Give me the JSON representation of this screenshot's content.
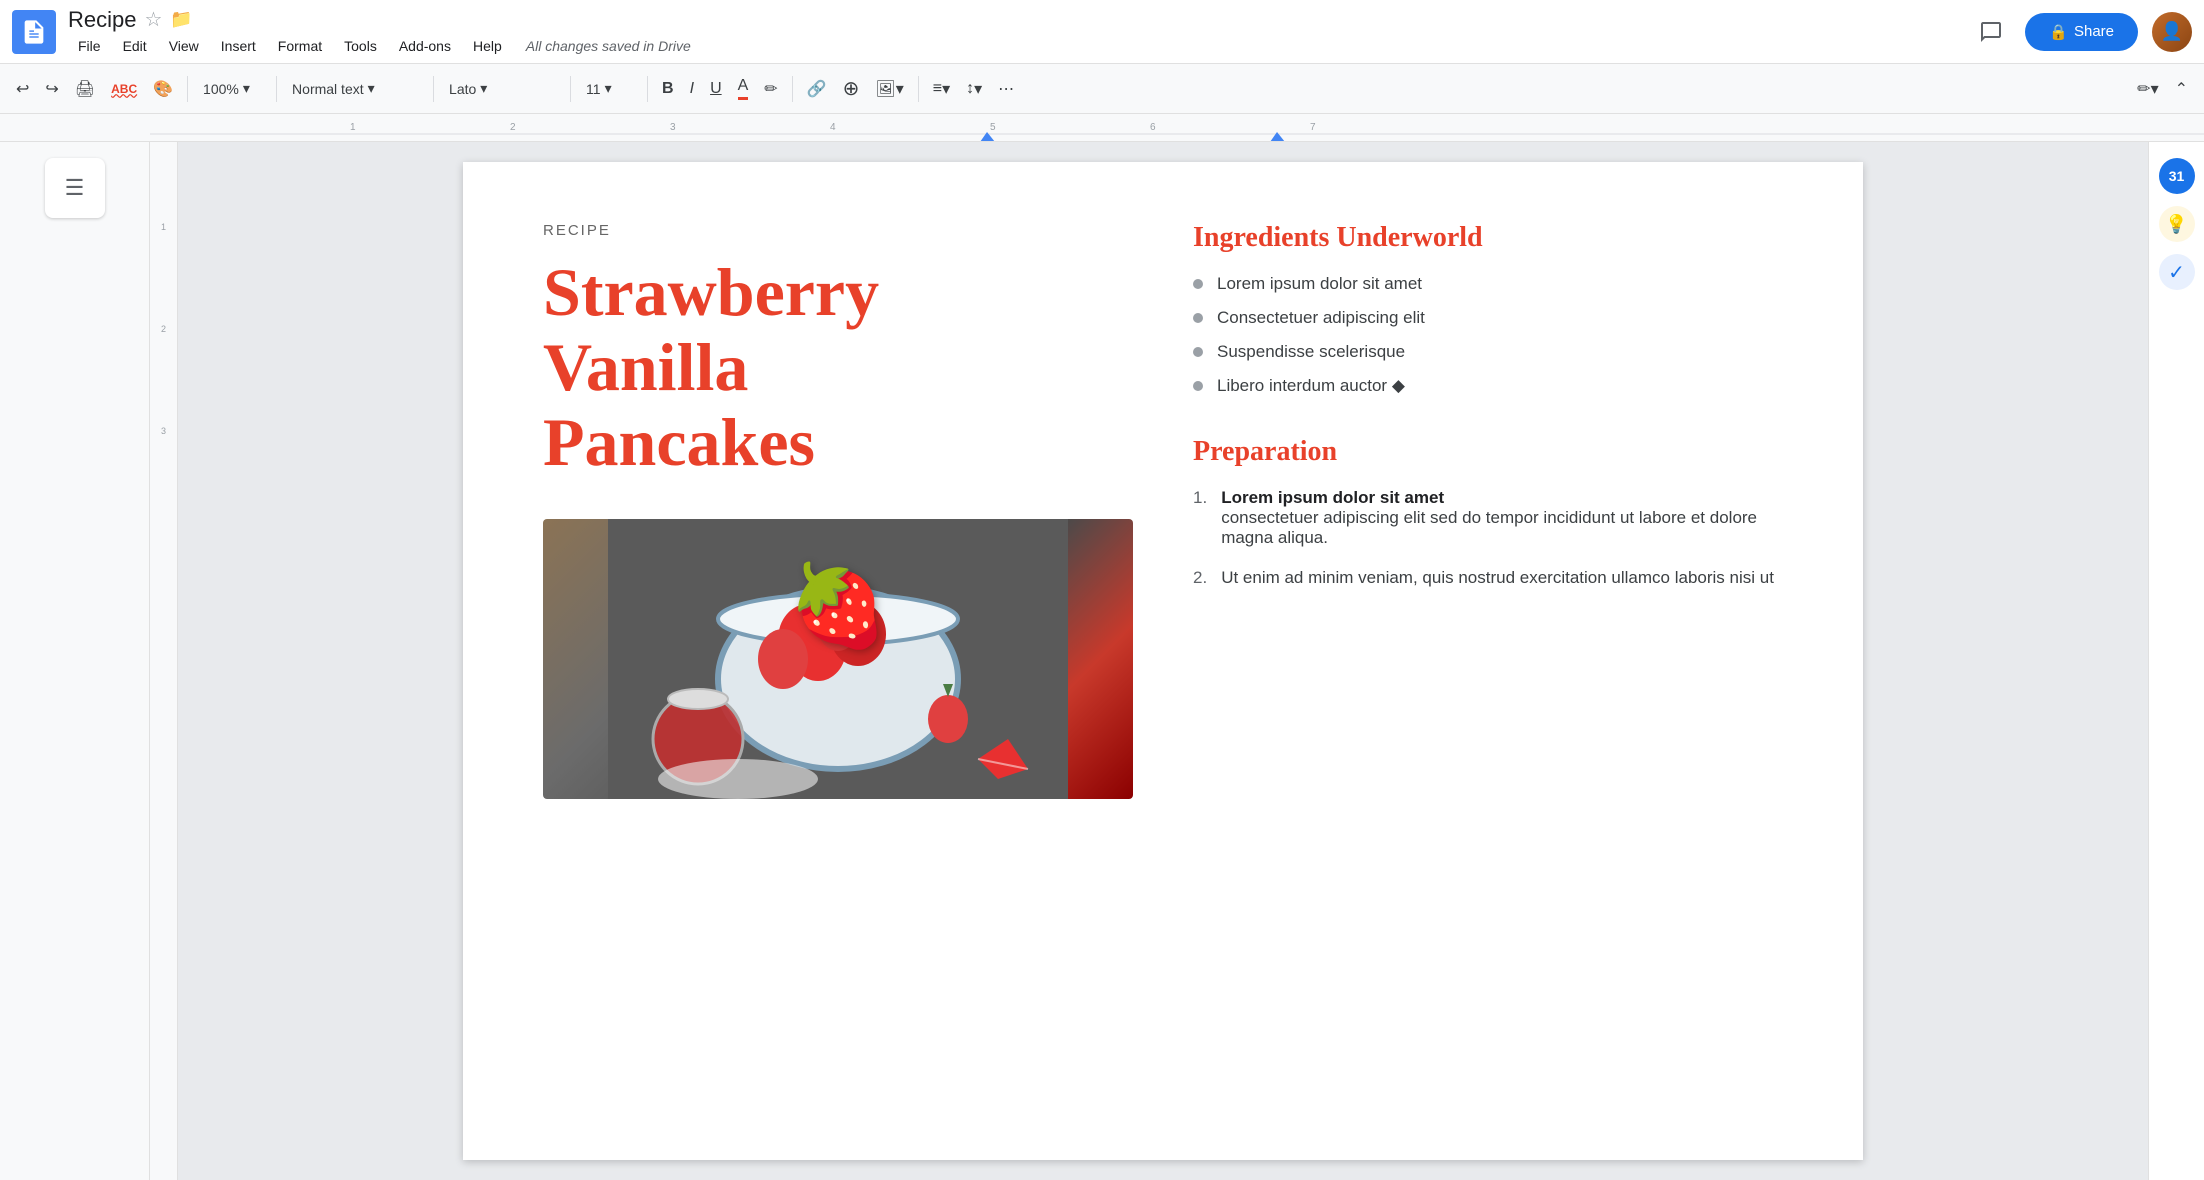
{
  "header": {
    "title": "Recipe",
    "saved_status": "All changes saved in Drive",
    "share_label": "Share"
  },
  "menu": {
    "items": [
      "File",
      "Edit",
      "View",
      "Insert",
      "Format",
      "Tools",
      "Add-ons",
      "Help"
    ]
  },
  "toolbar": {
    "zoom": "100%",
    "style": "Normal text",
    "font": "Lato",
    "size": "11",
    "zoom_label": "100%",
    "style_label": "Normal text",
    "font_label": "Lato",
    "size_label": "11"
  },
  "document": {
    "recipe_label": "RECIPE",
    "title_line1": "Strawberry",
    "title_line2": "Vanilla",
    "title_line3": "Pancakes",
    "ingredients_heading": "Ingredients Underworld",
    "ingredients": [
      "Lorem ipsum dolor sit amet",
      "Consectetuer adipiscing elit",
      "Suspendisse scelerisque",
      "Libero interdum auctor ◆"
    ],
    "preparation_heading": "Preparation",
    "prep_items": [
      {
        "num": "1.",
        "bold_text": "Lorem ipsum dolor sit amet",
        "body_text": "consectetuer adipiscing elit sed do tempor incididunt ut labore et dolore magna aliqua."
      },
      {
        "num": "2.",
        "bold_text": "",
        "body_text": "Ut enim ad minim veniam, quis nostrud exercitation ullamco laboris nisi ut"
      }
    ]
  },
  "right_sidebar": {
    "calendar_label": "31",
    "bulb_label": "💡",
    "check_label": "✓"
  },
  "icons": {
    "undo": "↩",
    "redo": "↪",
    "print": "🖨",
    "paint_format": "🖌",
    "spell_check": "ABC",
    "bold": "B",
    "italic": "I",
    "underline": "U",
    "text_color": "A",
    "highlight": "✏",
    "link": "🔗",
    "insert": "+",
    "image": "🖼",
    "align": "≡",
    "line_space": "↕",
    "more": "⋯",
    "pen": "✏",
    "collapse": "⌃",
    "outline": "☰",
    "comments": "💬",
    "lock": "🔒"
  }
}
